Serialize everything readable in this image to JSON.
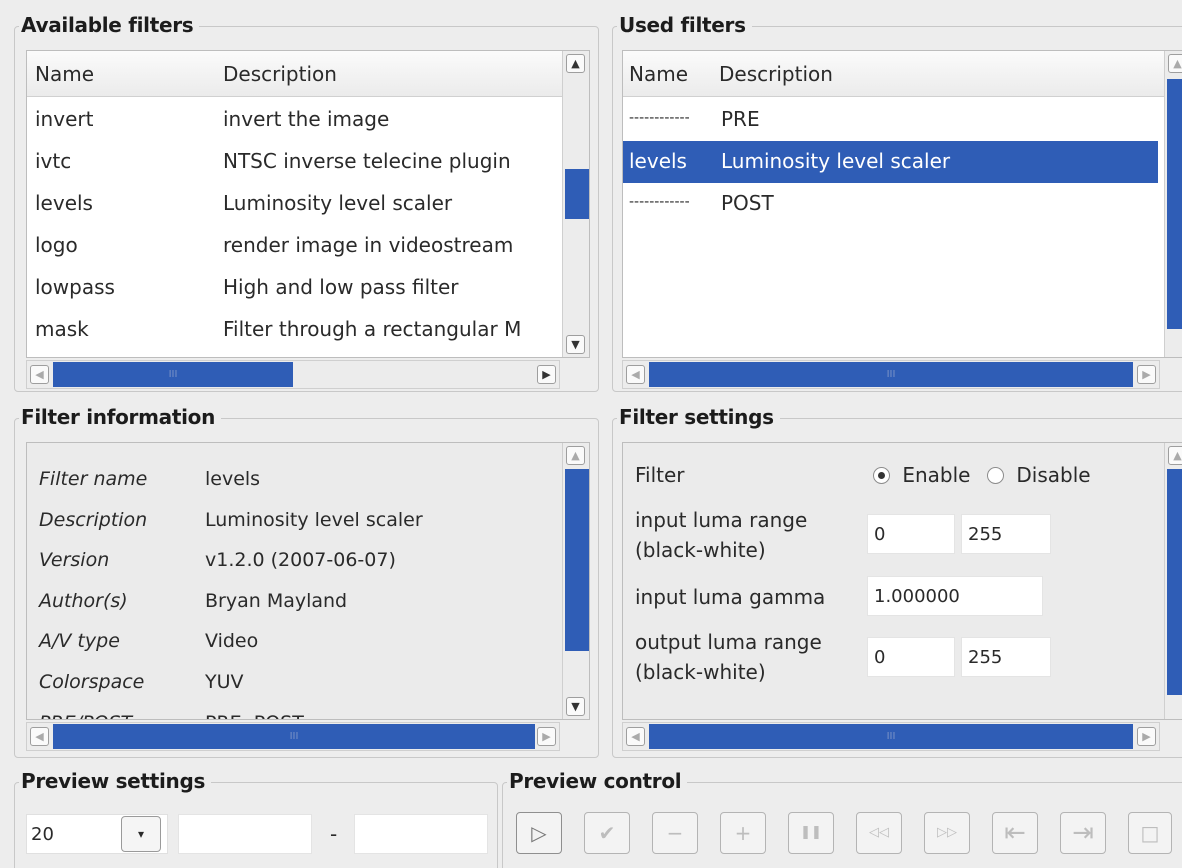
{
  "available_filters": {
    "title": "Available filters",
    "columns": [
      "Name",
      "Description"
    ],
    "rows": [
      {
        "name": "invert",
        "description": "invert the image"
      },
      {
        "name": "ivtc",
        "description": "NTSC inverse telecine plugin"
      },
      {
        "name": "levels",
        "description": "Luminosity level scaler"
      },
      {
        "name": "logo",
        "description": "render image in videostream"
      },
      {
        "name": "lowpass",
        "description": "High and low pass filter"
      },
      {
        "name": "mask",
        "description": "Filter through a rectangular M"
      }
    ],
    "hscroll_grip": "III"
  },
  "used_filters": {
    "title": "Used filters",
    "columns": [
      "Name",
      "Description"
    ],
    "rows": [
      {
        "name": "------------",
        "description": "PRE"
      },
      {
        "name": "levels",
        "description": "Luminosity level scaler",
        "selected": true
      },
      {
        "name": "------------",
        "description": "POST"
      }
    ],
    "hscroll_grip": "III"
  },
  "filter_information": {
    "title": "Filter information",
    "rows": [
      {
        "label": "Filter name",
        "value": "levels"
      },
      {
        "label": "Description",
        "value": "Luminosity level scaler"
      },
      {
        "label": "Version",
        "value": "v1.2.0 (2007-06-07)"
      },
      {
        "label": "Author(s)",
        "value": "Bryan Mayland"
      },
      {
        "label": "A/V type",
        "value": "Video"
      },
      {
        "label": "Colorspace",
        "value": "YUV"
      },
      {
        "label": "PRE/POST",
        "value": "PRE, POST"
      }
    ],
    "hscroll_grip": "III"
  },
  "filter_settings": {
    "title": "Filter settings",
    "filter_label": "Filter",
    "enable_label": "Enable",
    "disable_label": "Disable",
    "enabled": true,
    "input_luma_range_label_1": "input luma range",
    "input_luma_range_label_2": "(black-white)",
    "input_luma_min": "0",
    "input_luma_max": "255",
    "input_luma_gamma_label": "input luma gamma",
    "input_luma_gamma": "1.000000",
    "output_luma_range_label_1": "output luma range",
    "output_luma_range_label_2": "(black-white)",
    "output_luma_min": "0",
    "output_luma_max": "255",
    "hscroll_grip": "III"
  },
  "preview_settings": {
    "title": "Preview settings",
    "value": "20",
    "range_separator": "-",
    "range_start": "",
    "range_end": ""
  },
  "preview_control": {
    "title": "Preview control",
    "buttons": [
      {
        "icon": "play-icon",
        "glyph": "▷"
      },
      {
        "icon": "apply-check-icon",
        "glyph": "✔"
      },
      {
        "icon": "remove-minus-icon",
        "glyph": "−"
      },
      {
        "icon": "add-plus-icon",
        "glyph": "+"
      },
      {
        "icon": "pause-icon",
        "glyph": "❚❚"
      },
      {
        "icon": "rewind-icon",
        "glyph": "◁◁"
      },
      {
        "icon": "fast-forward-icon",
        "glyph": "▷▷"
      },
      {
        "icon": "skip-to-start-icon",
        "glyph": "⇤"
      },
      {
        "icon": "skip-to-end-icon",
        "glyph": "⇥"
      },
      {
        "icon": "stop-icon",
        "glyph": "□"
      }
    ]
  },
  "colors": {
    "selection": "#2f5db6",
    "window": "#ededed"
  }
}
